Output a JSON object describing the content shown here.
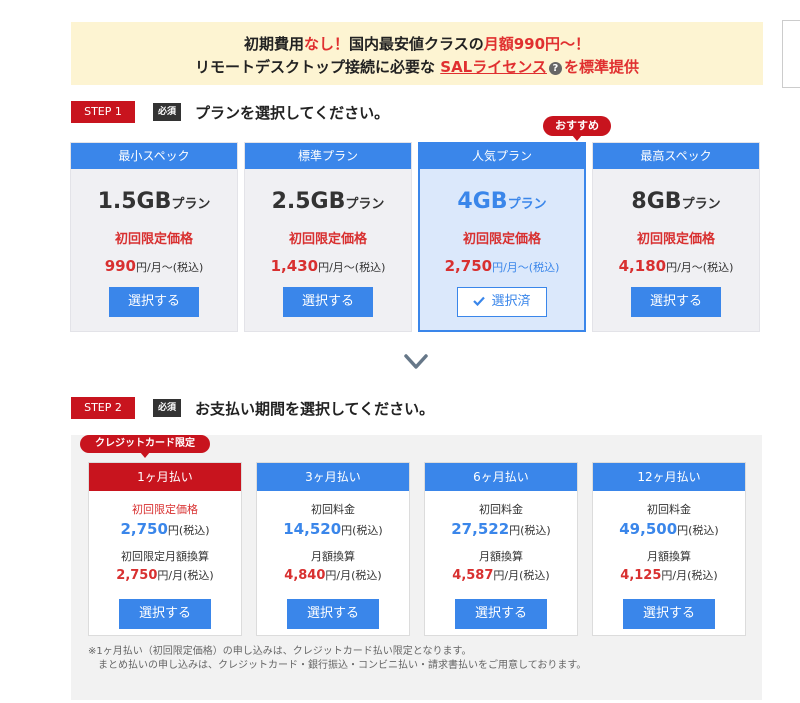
{
  "banner": {
    "line1_a": "初期費用",
    "line1_b": "なし！",
    "line1_c": "国内最安値クラスの",
    "line1_d": "月額990円〜！",
    "line2_a": "リモートデスクトップ接続に必要な ",
    "line2_link": "SALライセンス",
    "line2_icon": "?",
    "line2_b": "を標準提供"
  },
  "step1": {
    "badge": "STEP 1",
    "required": "必須",
    "title": "プランを選択してください。",
    "recommend_tag": "おすすめ"
  },
  "plans": [
    {
      "header": "最小スペック",
      "name": "1.5GB",
      "suffix": "プラン",
      "limited": "初回限定価格",
      "price": "990",
      "unit": "円/月〜(税込)",
      "button": "選択する"
    },
    {
      "header": "標準プラン",
      "name": "2.5GB",
      "suffix": "プラン",
      "limited": "初回限定価格",
      "price": "1,430",
      "unit": "円/月〜(税込)",
      "button": "選択する"
    },
    {
      "header": "人気プラン",
      "name": "4GB",
      "suffix": "プラン",
      "limited": "初回限定価格",
      "price": "2,750",
      "unit": "円/月〜(税込)",
      "button": "選択済"
    },
    {
      "header": "最高スペック",
      "name": "8GB",
      "suffix": "プラン",
      "limited": "初回限定価格",
      "price": "4,180",
      "unit": "円/月〜(税込)",
      "button": "選択する"
    }
  ],
  "step2": {
    "badge": "STEP 2",
    "required": "必須",
    "title": "お支払い期間を選択してください。",
    "credit_tag": "クレジットカード限定"
  },
  "periods": [
    {
      "header": "1ヶ月払い",
      "label1": "初回限定価格",
      "value1": "2,750",
      "unit1": "円(税込)",
      "label2": "初回限定月額換算",
      "value2": "2,750",
      "unit2": "円/月(税込)",
      "button": "選択する"
    },
    {
      "header": "3ヶ月払い",
      "label1": "初回料金",
      "value1": "14,520",
      "unit1": "円(税込)",
      "label2": "月額換算",
      "value2": "4,840",
      "unit2": "円/月(税込)",
      "button": "選択する"
    },
    {
      "header": "6ヶ月払い",
      "label1": "初回料金",
      "value1": "27,522",
      "unit1": "円(税込)",
      "label2": "月額換算",
      "value2": "4,587",
      "unit2": "円/月(税込)",
      "button": "選択する"
    },
    {
      "header": "12ヶ月払い",
      "label1": "初回料金",
      "value1": "49,500",
      "unit1": "円(税込)",
      "label2": "月額換算",
      "value2": "4,125",
      "unit2": "円/月(税込)",
      "button": "選択する"
    }
  ],
  "notes": {
    "line1": "※1ヶ月払い（初回限定価格）の申し込みは、クレジットカード払い限定となります。",
    "line2": "まとめ払いの申し込みは、クレジットカード・銀行振込・コンビニ払い・請求書払いをご用意しております。"
  },
  "colors": {
    "accent_blue": "#3a86ea",
    "accent_red": "#c8141e",
    "banner_bg": "#fdf4d2"
  }
}
